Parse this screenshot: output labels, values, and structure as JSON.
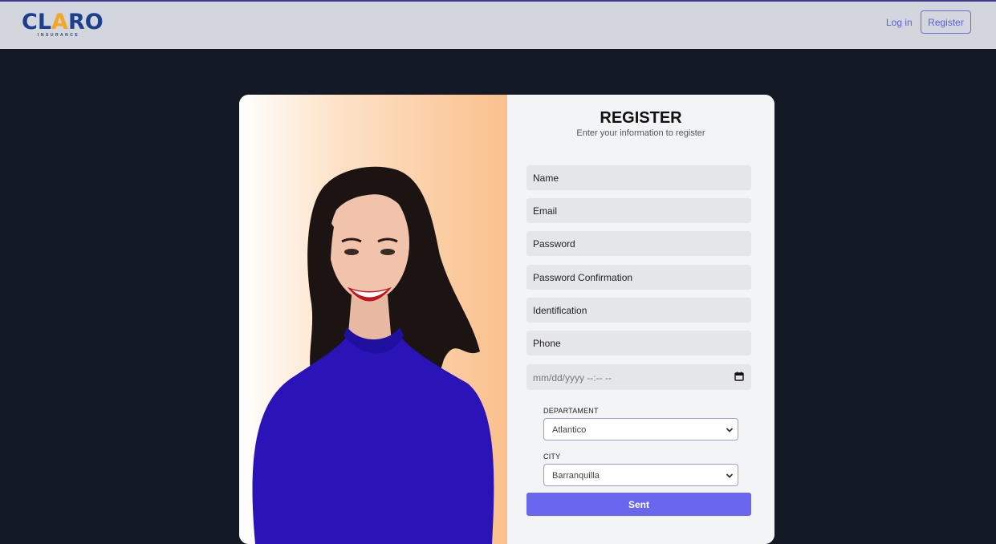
{
  "header": {
    "logo_text_1": "CL",
    "logo_text_a": "A",
    "logo_text_2": "RO",
    "logo_sub": "INSURANCE",
    "login_label": "Log in",
    "register_label": "Register"
  },
  "form": {
    "title": "REGISTER",
    "subtitle": "Enter your information to register",
    "name_placeholder": "Name",
    "email_placeholder": "Email",
    "password_placeholder": "Password",
    "password_confirmation_placeholder": "Password Confirmation",
    "identification_placeholder": "Identification",
    "phone_placeholder": "Phone",
    "date_placeholder": "mm/dd/yyyy --:-- --",
    "department_label": "DEPARTAMENT",
    "department_value": "Atlantico",
    "city_label": "CITY",
    "city_value": "Barranquilla",
    "submit_label": "Sent"
  },
  "colors": {
    "accent": "#6a67ee",
    "page_bg": "#141926",
    "header_bg": "#d3d6dd",
    "logo_blue": "#1d3f8f",
    "logo_orange": "#f5a623"
  },
  "icons": {
    "date": "calendar-icon",
    "select": "chevron-down-icon"
  }
}
